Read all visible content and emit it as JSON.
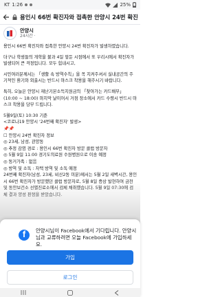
{
  "status_bar": {
    "carrier": "KT",
    "time": "1:26",
    "battery": "25%"
  },
  "app_bar": {
    "title": "용인시 66번 확진자와 접촉한 안양시 24번 확진자..."
  },
  "post": {
    "author": "안양시",
    "time": "24시간 ·",
    "lines": [
      "용인시 66번 확진자와 접촉한 안양시 24번 확진자가 발생하였습니다.",
      "더구나 학생들의 개학을 불과 4일 앞둔 시점에서 또 우리시에서 확진자가 발생되어 큰 걱정입니다. 모두 힘내시고,",
      "시민여러분께서는 「생활 속 방역수칙」을 꼭 지켜주셔서 실내공간의 주기적인 환기와 외출시는 반드시 마스크 착용을 해주시기 바랍니다.",
      "특히, 오늘은 안양시 재난기본소득지원금의 「찾아가는 카드배부」 (10:00 ~ 18:00) 마지막 날이어서 거점 장소에서 카드 수령시 반드시 마스크 착용을 당부 드립니다.",
      "5월9일(토) 10:30 기준",
      "<코로나19 안양시 '24번째 확진자' 발생>",
      "📌📌",
      "☐ 안양시 24번 확진자 정보",
      "◎ 23세, 남성, 관양동",
      "◎ 추정 감염 경로 : 용인시 66번 확진자 방문 클럽 방문자",
      "◎ 5월 9일 11:00 경기도의료원 수원병원으로 이송 예정",
      "◎ 동거가족 : 없음",
      "◎ 방역 및 소독 : 자택 방역 및 소독 예정",
      "24번째 확진자(남성, 23세, 비산2동 미분)께서는 5월 2일 새벽시간, 용인시 66번 확진자가 방문했던 클럽 방문자로, 5월 8일 증상 발현하여 금천 및 동안보건소 선별진료소에서 검체 채취했습니다. 5월 9일 07:30에 검체 결과 양성 판정을 받았습니다."
    ]
  },
  "signup_sheet": {
    "message": "안양시님이 Facebook에서 기다립니다. 안양시님과 교류하려면 오늘 Facebook에 가입하세요.",
    "join_label": "가입",
    "login_label": "로그인"
  },
  "colors": {
    "facebook_blue": "#1877f2",
    "button_blue": "#1b74e4"
  }
}
